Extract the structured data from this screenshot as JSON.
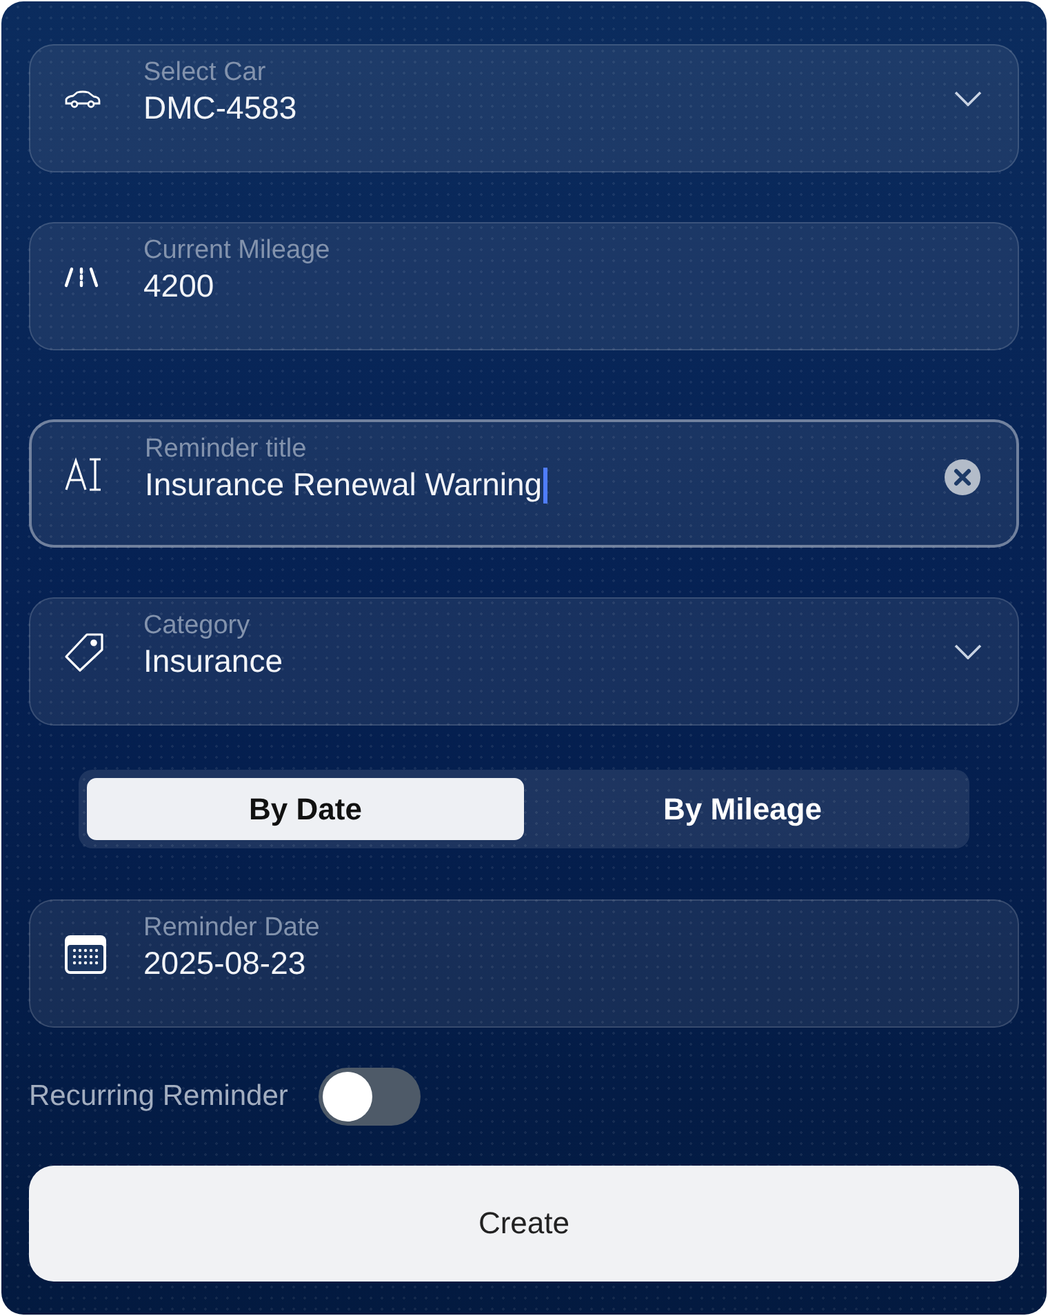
{
  "fields": [
    {
      "kind": "select",
      "label": "Select Car",
      "value": "DMC-4583",
      "focused": false
    },
    {
      "kind": "text",
      "label": "Current Mileage",
      "value": "4200",
      "focused": false
    },
    {
      "kind": "text",
      "label": "Reminder title",
      "value": "Insurance Renewal Warning",
      "focused": true
    },
    {
      "kind": "select",
      "label": "Category",
      "value": "Insurance",
      "focused": false
    }
  ],
  "segments": [
    {
      "label": "By Date",
      "selected": true
    },
    {
      "label": "By Mileage",
      "selected": false
    }
  ],
  "date_field": {
    "label": "Reminder Date",
    "value": "2025-08-23"
  },
  "recurring": {
    "label": "Recurring Reminder",
    "on": false
  },
  "create_button": "Create"
}
